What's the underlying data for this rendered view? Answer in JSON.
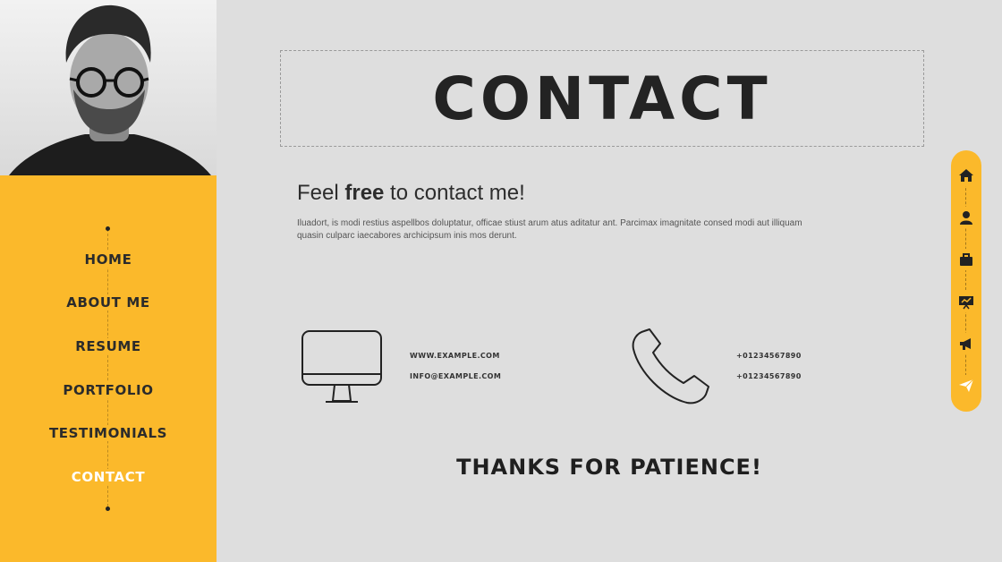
{
  "sidebar": {
    "menu": [
      {
        "label": "HOME",
        "active": false
      },
      {
        "label": "ABOUT ME",
        "active": false
      },
      {
        "label": "RESUME",
        "active": false
      },
      {
        "label": "PORTFOLIO",
        "active": false
      },
      {
        "label": "TESTIMONIALS",
        "active": false
      },
      {
        "label": "CONTACT",
        "active": true
      }
    ]
  },
  "main": {
    "title": "CONTACT",
    "heading_pre": "Feel ",
    "heading_bold": "free",
    "heading_post": " to contact me!",
    "body": "Iluadort, is modi restius aspellbos doluptatur, officae stiust arum atus aditatur ant. Parcimax imagnitate consed modi aut illiquam quasin culparc iaecabores archicipsum inis mos derunt.",
    "web": {
      "icon": "desktop-monitor-icon",
      "lines": [
        "WWW.EXAMPLE.COM",
        "INFO@EXAMPLE.COM"
      ]
    },
    "phone": {
      "icon": "phone-handset-icon",
      "lines": [
        "+01234567890",
        "+01234567890"
      ]
    },
    "thanks": "THANKS FOR PATIENCE!"
  },
  "rail": {
    "icons": [
      "home-icon",
      "user-icon",
      "briefcase-icon",
      "presentation-icon",
      "megaphone-icon",
      "paper-plane-icon"
    ]
  },
  "colors": {
    "accent": "#fbb92b",
    "background": "#dedede",
    "text": "#222222",
    "active_menu": "#ffffff"
  }
}
